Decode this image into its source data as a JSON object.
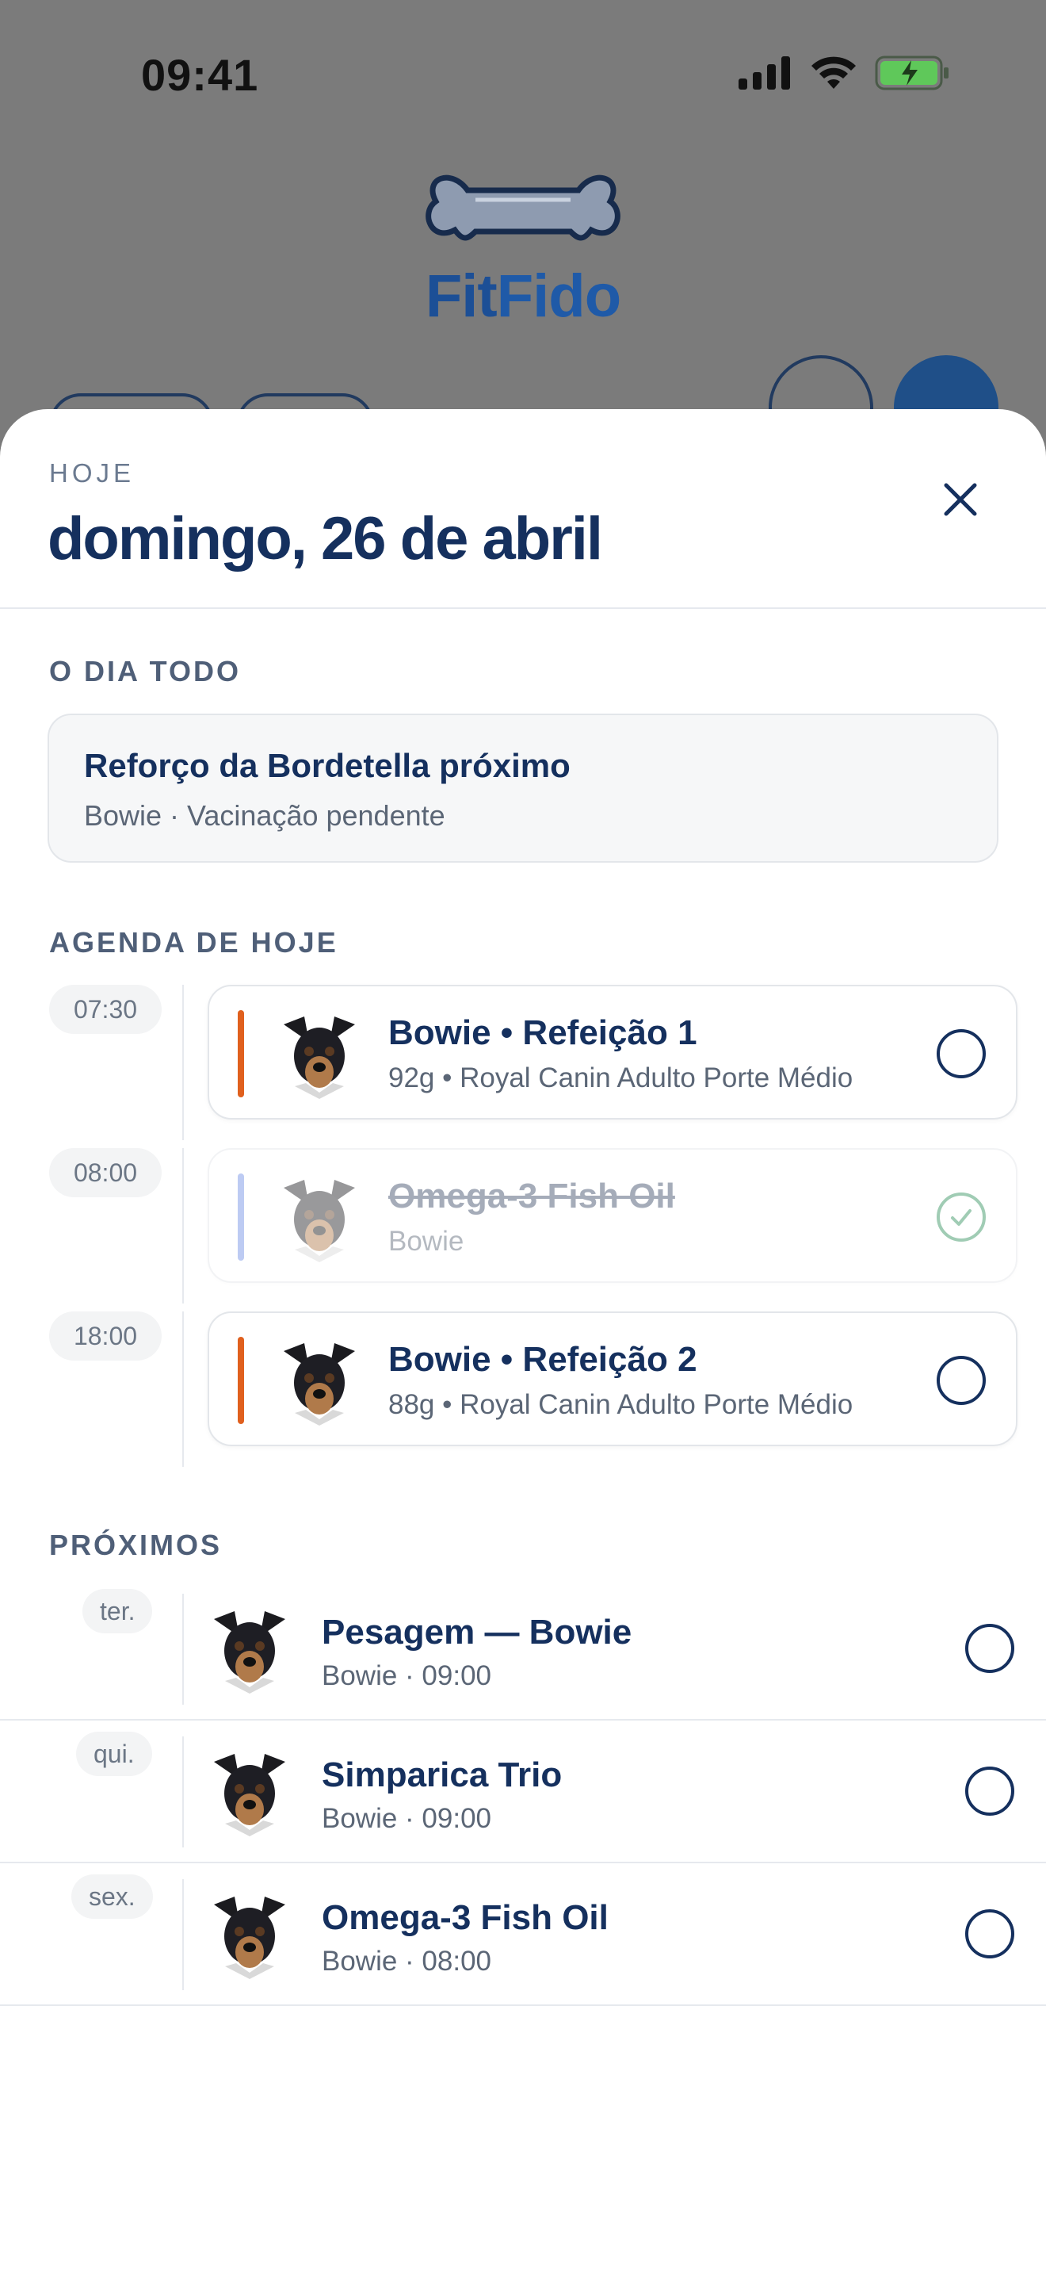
{
  "status_bar": {
    "time": "09:41"
  },
  "app": {
    "logo_fit": "Fit",
    "logo_fido": "Fido"
  },
  "sheet": {
    "eyebrow": "HOJE",
    "title": "domingo, 26 de abril",
    "all_day": {
      "label": "O DIA TODO",
      "title": "Reforço da Bordetella próximo",
      "subtitle": "Bowie · Vacinação pendente"
    },
    "schedule": {
      "label": "AGENDA DE HOJE",
      "items": [
        {
          "time": "07:30",
          "title": "Bowie • Refeição 1",
          "subtitle": "92g • Royal Canin Adulto Porte Médio",
          "done": false,
          "accent": "#e0601e"
        },
        {
          "time": "08:00",
          "title": "Omega-3 Fish Oil",
          "subtitle": "Bowie",
          "done": true,
          "accent": "#6f8ee6"
        },
        {
          "time": "18:00",
          "title": "Bowie • Refeição 2",
          "subtitle": "88g • Royal Canin Adulto Porte Médio",
          "done": false,
          "accent": "#e0601e"
        }
      ]
    },
    "upcoming": {
      "label": "PRÓXIMOS",
      "items": [
        {
          "day": "ter.",
          "title": "Pesagem — Bowie",
          "subtitle": "Bowie · 09:00"
        },
        {
          "day": "qui.",
          "title": "Simparica Trio",
          "subtitle": "Bowie · 09:00"
        },
        {
          "day": "sex.",
          "title": "Omega-3 Fish Oil",
          "subtitle": "Bowie · 08:00"
        }
      ]
    }
  },
  "colors": {
    "primary": "#15305e",
    "meal_accent": "#e0601e",
    "supplement_accent": "#6f8ee6",
    "done_check": "#2f8f5b",
    "battery": "#5fc85a"
  },
  "icons": [
    "signal-icon",
    "wifi-icon",
    "battery-charging-icon",
    "bone-logo-icon",
    "close-icon",
    "dog-avatar-icon",
    "checkmark-icon"
  ]
}
